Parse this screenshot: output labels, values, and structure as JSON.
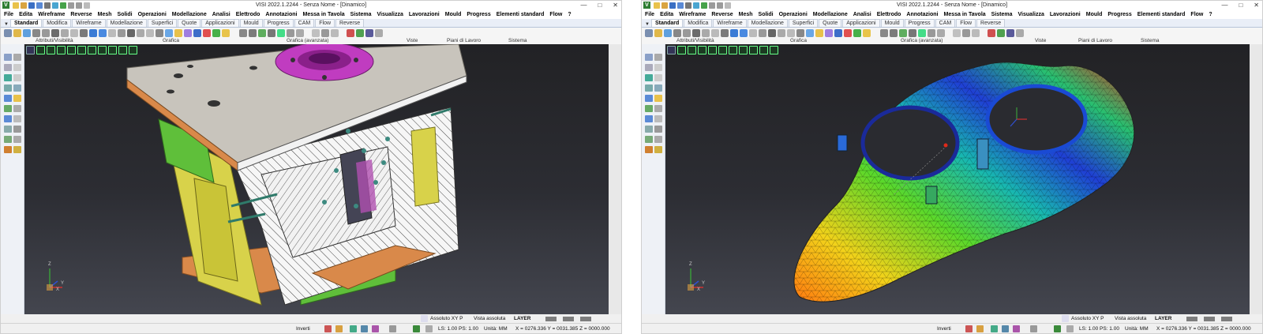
{
  "windows": [
    {
      "title": "VISI 2022.1.2244 - Senza Nome - [Dinamico]",
      "app_icon": "V",
      "menu": [
        "File",
        "Edita",
        "Wireframe",
        "Reverse",
        "Mesh",
        "Solidi",
        "Operazioni",
        "Modellazione",
        "Analisi",
        "Elettrodo",
        "Annotazioni",
        "Messa in Tavola",
        "Sistema",
        "Visualizza",
        "Lavorazioni",
        "Mould",
        "Progress",
        "Elementi standard",
        "Flow",
        "?"
      ],
      "tabs": [
        "Standard",
        "Modifica",
        "Wireframe",
        "Modellazione",
        "Superfici",
        "Quote",
        "Applicazioni",
        "Mould",
        "Progress",
        "CAM",
        "Flow",
        "Reverse"
      ],
      "active_tab": "Standard",
      "groups": [
        "Attributi/Visibilità",
        "Grafica",
        "Grafica (avanzata)",
        "Viste",
        "Piani di Lavoro",
        "Sistema"
      ],
      "status": {
        "plane": "Assoluto XY P",
        "view": "Vista assoluta",
        "layer": "LAYER",
        "invert": "Inverti",
        "ls": "LS: 1.00 PS: 1.00",
        "units": "Unità: MM",
        "coords": "X = 0276.336 Y = 0031.385 Z = 0000.000"
      },
      "axes": {
        "x": "X",
        "y": "Y",
        "z": "Z"
      }
    },
    {
      "title": "VISI 2022.1.2244 - Senza Nome - [Dinamico]",
      "app_icon": "V",
      "menu": [
        "File",
        "Edita",
        "Wireframe",
        "Reverse",
        "Mesh",
        "Solidi",
        "Operazioni",
        "Modellazione",
        "Analisi",
        "Elettrodo",
        "Annotazioni",
        "Messa in Tavola",
        "Sistema",
        "Visualizza",
        "Lavorazioni",
        "Mould",
        "Progress",
        "Elementi standard",
        "Flow",
        "?"
      ],
      "tabs": [
        "Standard",
        "Modifica",
        "Wireframe",
        "Modellazione",
        "Superfici",
        "Quote",
        "Applicazioni",
        "Mould",
        "Progress",
        "CAM",
        "Flow",
        "Reverse"
      ],
      "active_tab": "Standard",
      "groups": [
        "Attributi/Visibilità",
        "Grafica",
        "Grafica (avanzata)",
        "Viste",
        "Piani di Lavoro",
        "Sistema"
      ],
      "status": {
        "plane": "Assoluto XY P",
        "view": "Vista assoluta",
        "layer": "LAYER",
        "invert": "Inverti",
        "ls": "LS: 1.00 PS: 1.00",
        "units": "Unità: MM",
        "coords": "X = 0276.336 Y = 0031.385 Z = 0000.000"
      },
      "axes": {
        "x": "X",
        "y": "Y",
        "z": "Z"
      }
    }
  ],
  "icons": [
    "app-logo-icon",
    "save-icon",
    "open-icon",
    "print-icon",
    "undo-icon",
    "redo-icon",
    "minimize-icon",
    "maximize-icon",
    "close-icon"
  ],
  "colors": {
    "accent": "#0b5fb5",
    "mold_steel": "#c8c4bc",
    "mold_yellow": "#d8d24a",
    "mold_green": "#5fbf3a",
    "mold_orange": "#d9894a",
    "mold_magenta": "#c03cc0",
    "mesh_blue": "#1f3fd4",
    "mesh_red": "#e02a1a"
  }
}
